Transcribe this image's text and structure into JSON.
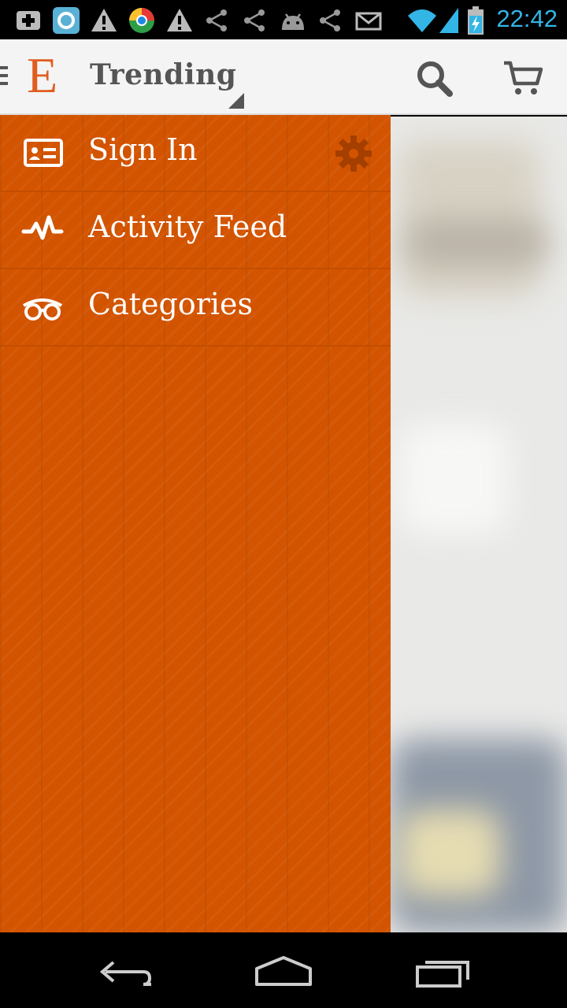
{
  "status_bar": {
    "time": "22:42",
    "icons": [
      "add-icon",
      "app-icon",
      "warning-icon",
      "chrome-icon",
      "warning-icon",
      "share-icon",
      "share-icon",
      "android-icon",
      "share-icon",
      "mail-icon",
      "wifi-icon",
      "signal-icon",
      "battery-icon"
    ]
  },
  "action_bar": {
    "logo": "E",
    "title": "Trending",
    "icons": [
      "menu-icon",
      "search-icon",
      "cart-icon"
    ]
  },
  "drawer": {
    "items": [
      {
        "label": "Sign In",
        "icon": "id-card-icon"
      },
      {
        "label": "Activity Feed",
        "icon": "activity-icon"
      },
      {
        "label": "Categories",
        "icon": "glasses-icon"
      }
    ],
    "settings_icon": "gear-icon",
    "colors": {
      "background": "#d35400",
      "divider": "#c24d00",
      "text": "#ffffff"
    }
  },
  "nav_bar": {
    "icons": [
      "back-icon",
      "home-icon",
      "recent-apps-icon"
    ]
  }
}
